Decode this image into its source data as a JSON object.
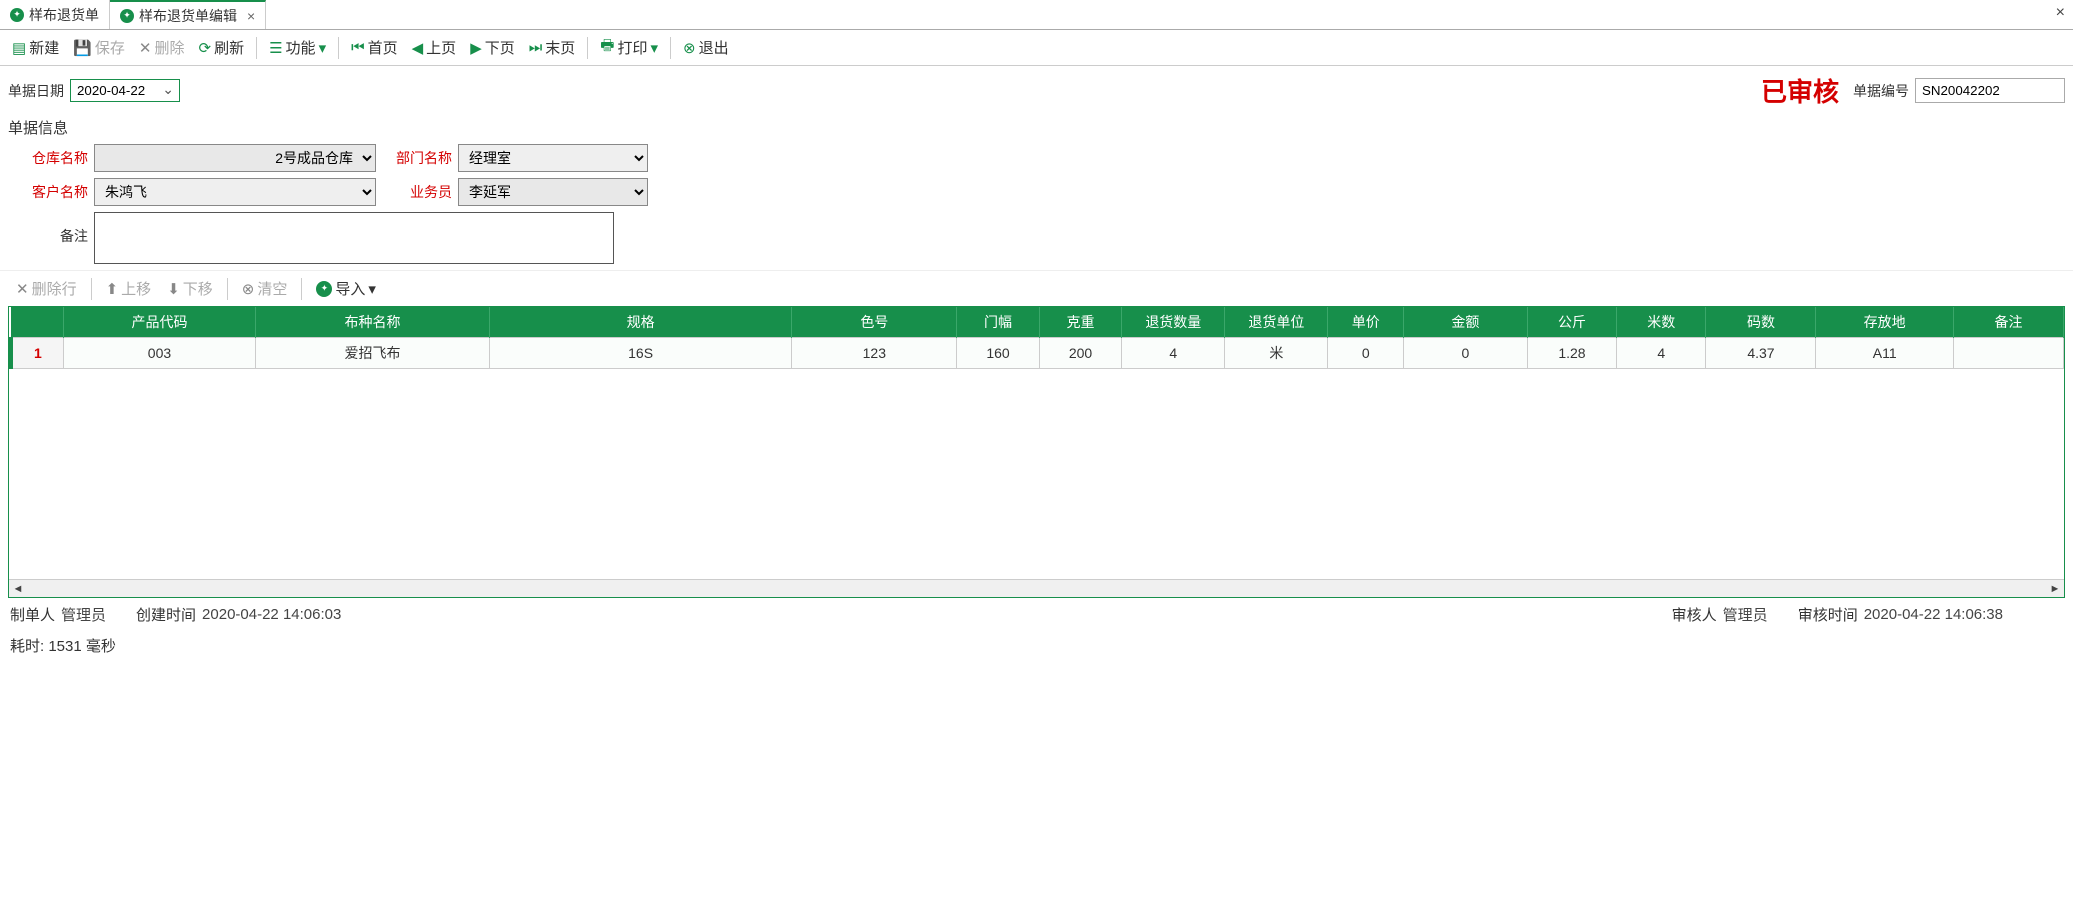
{
  "tabs": [
    {
      "label": "样布退货单",
      "active": false
    },
    {
      "label": "样布退货单编辑",
      "active": true
    }
  ],
  "toolbar": {
    "new": "新建",
    "save": "保存",
    "delete": "删除",
    "refresh": "刷新",
    "functions": "功能",
    "first": "首页",
    "prev": "上页",
    "next": "下页",
    "last": "末页",
    "print": "打印",
    "exit": "退出"
  },
  "header": {
    "date_label": "单据日期",
    "date_value": "2020-04-22",
    "audit_stamp": "已审核",
    "doc_no_label": "单据编号",
    "doc_no_value": "SN20042202"
  },
  "section_title": "单据信息",
  "form": {
    "warehouse_label": "仓库名称",
    "warehouse_value": "2号成品仓库",
    "dept_label": "部门名称",
    "dept_value": "经理室",
    "customer_label": "客户名称",
    "customer_value": "朱鸿飞",
    "salesman_label": "业务员",
    "salesman_value": "李延军",
    "remark_label": "备注",
    "remark_value": ""
  },
  "row_toolbar": {
    "delete_row": "删除行",
    "move_up": "上移",
    "move_down": "下移",
    "clear": "清空",
    "import": "导入"
  },
  "grid": {
    "headers": [
      "产品代码",
      "布种名称",
      "规格",
      "色号",
      "门幅",
      "克重",
      "退货数量",
      "退货单位",
      "单价",
      "金额",
      "公斤",
      "米数",
      "码数",
      "存放地",
      "备注"
    ],
    "rows": [
      {
        "num": "1",
        "cells": [
          "003",
          "爱招飞布",
          "16S",
          "123",
          "160",
          "200",
          "4",
          "米",
          "0",
          "0",
          "1.28",
          "4",
          "4.37",
          "A11",
          ""
        ]
      }
    ]
  },
  "footer": {
    "maker_label": "制单人",
    "maker_value": "管理员",
    "create_time_label": "创建时间",
    "create_time_value": "2020-04-22 14:06:03",
    "auditor_label": "审核人",
    "auditor_value": "管理员",
    "audit_time_label": "审核时间",
    "audit_time_value": "2020-04-22 14:06:38"
  },
  "status": {
    "elapsed_label": "耗时:",
    "elapsed_value": "1531 毫秒"
  }
}
